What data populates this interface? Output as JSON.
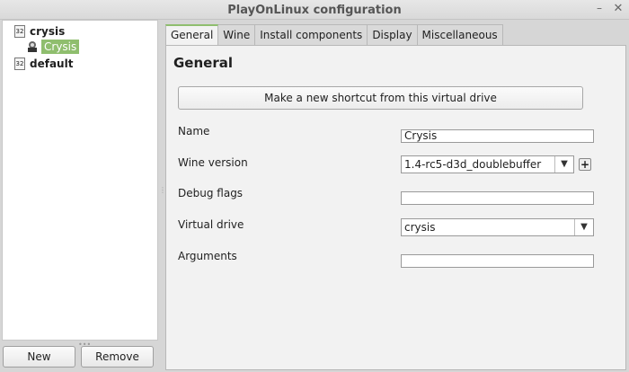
{
  "window": {
    "title": "PlayOnLinux configuration",
    "minimize": "–",
    "close": "✕"
  },
  "tree": {
    "items": [
      {
        "icon": "32",
        "label": "crysis"
      },
      {
        "label": "Crysis"
      },
      {
        "icon": "32",
        "label": "default"
      }
    ]
  },
  "left_buttons": {
    "new_label": "New",
    "remove_label": "Remove"
  },
  "tabs": [
    "General",
    "Wine",
    "Install components",
    "Display",
    "Miscellaneous"
  ],
  "general": {
    "heading": "General",
    "shortcut_button": "Make a new shortcut from this virtual drive",
    "name_label": "Name",
    "name_value": "Crysis",
    "wine_label": "Wine version",
    "wine_value": "1.4-rc5-d3d_doublebuffer",
    "plus": "+",
    "debug_label": "Debug flags",
    "debug_value": "",
    "drive_label": "Virtual drive",
    "drive_value": "crysis",
    "arguments_label": "Arguments",
    "arguments_value": ""
  },
  "colors": {
    "accent": "#8fbe6e"
  }
}
